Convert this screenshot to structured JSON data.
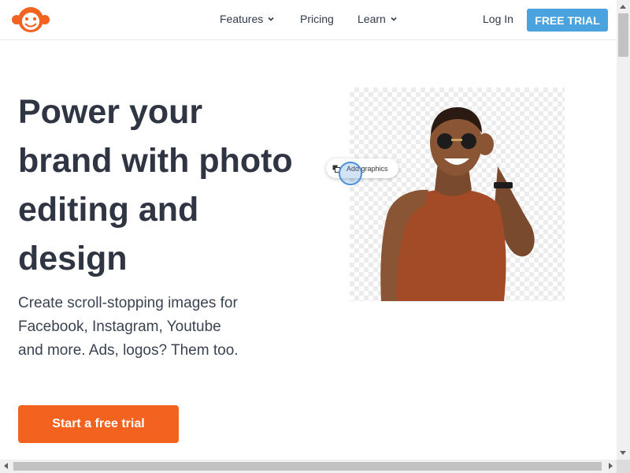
{
  "header": {
    "logo_icon": "monkey-logo-icon",
    "nav": [
      {
        "label": "Features",
        "has_dropdown": true
      },
      {
        "label": "Pricing",
        "has_dropdown": false
      },
      {
        "label": "Learn",
        "has_dropdown": true
      }
    ],
    "login_label": "Log In",
    "trial_label": "FREE TRIAL"
  },
  "hero": {
    "title": "Power your brand with photo editing and design",
    "subtitle": "Create scroll-stopping images for Facebook, Instagram, Youtube and more. Ads, logos? Them too.",
    "cta_label": "Start a free trial"
  },
  "preview": {
    "tooltip_label": "Add graphics",
    "tooltip_icon": "layers-icon"
  },
  "colors": {
    "brand_orange": "#f4621f",
    "trial_blue": "#4aa3df",
    "heading": "#2f3542"
  }
}
